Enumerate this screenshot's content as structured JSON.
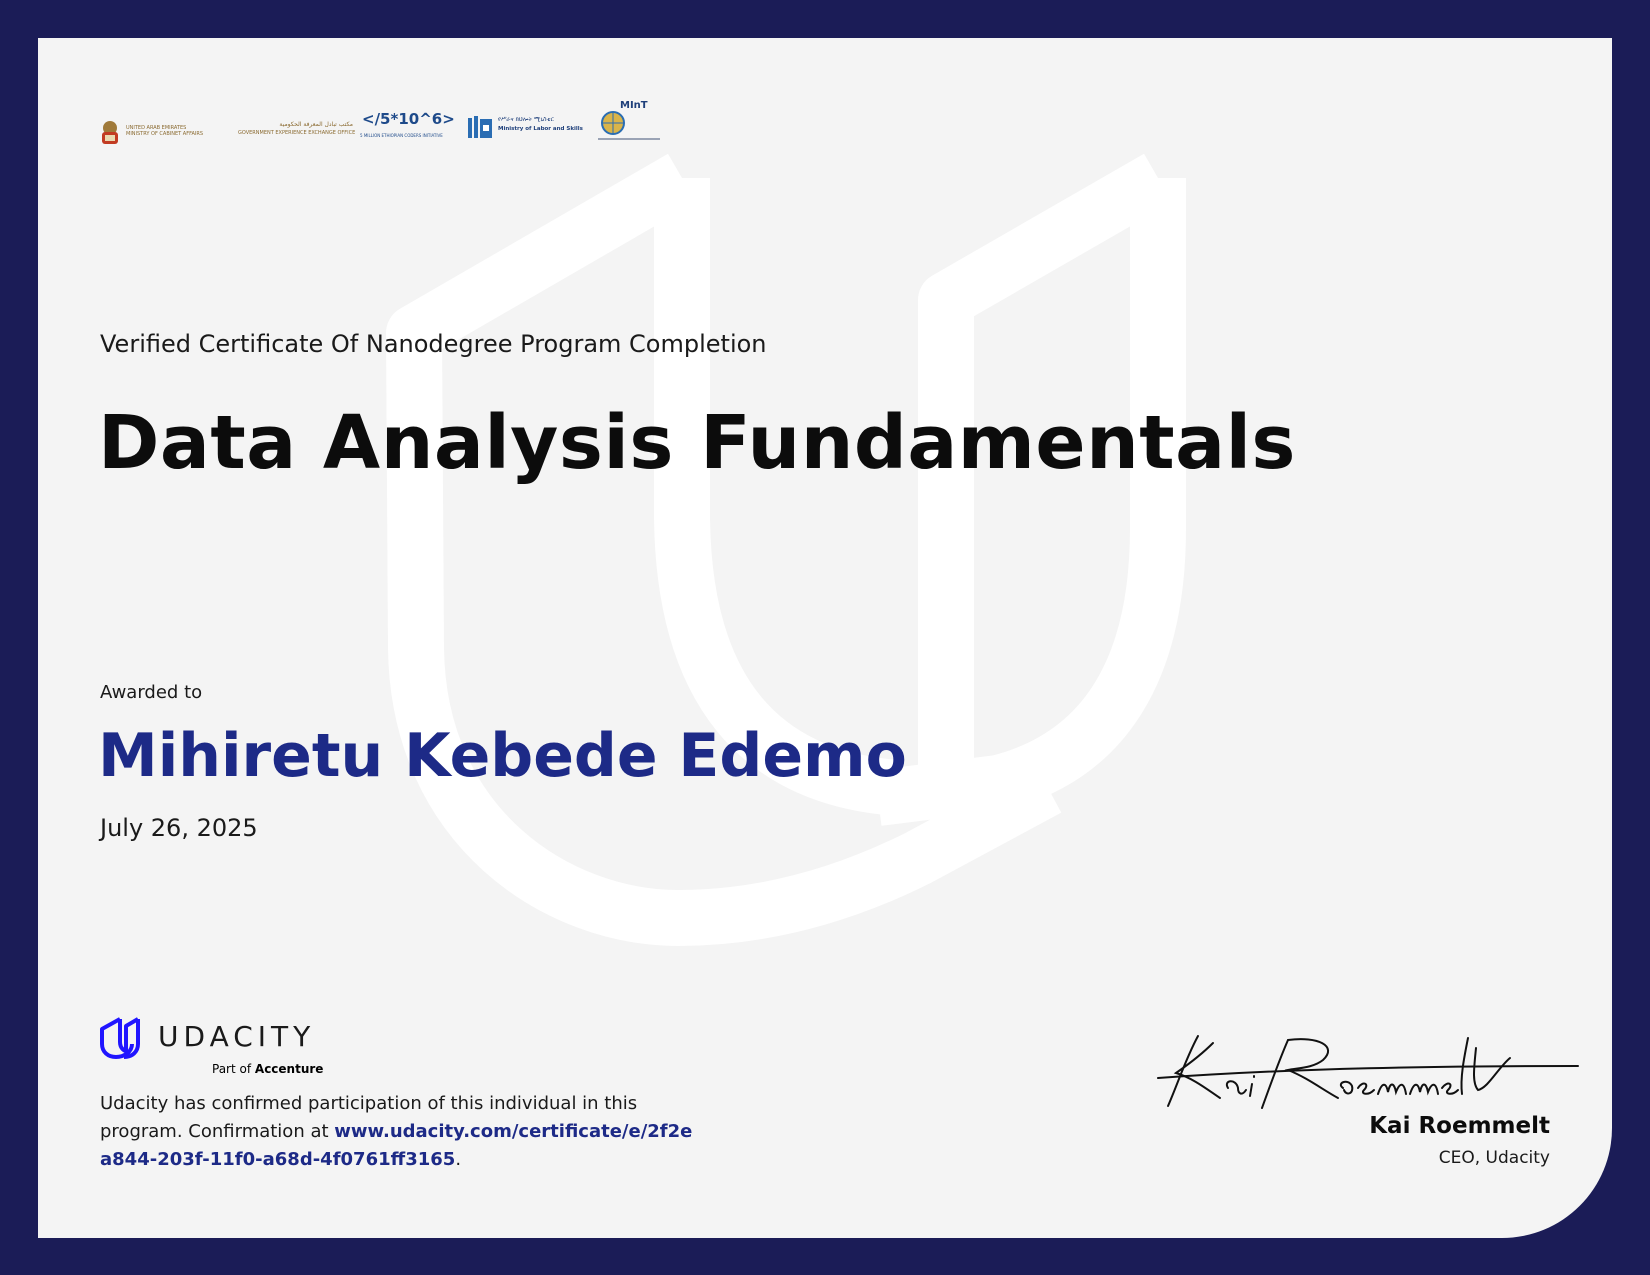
{
  "certificate": {
    "subtitle": "Verified Certificate Of Nanodegree Program Completion",
    "course_title": "Data Analysis Fundamentals",
    "awarded_label": "Awarded to",
    "recipient": "Mihiretu Kebede Edemo",
    "date": "July 26, 2025"
  },
  "partner_logos": [
    {
      "name": "uae-ministry-logo",
      "line1": "UNITED ARAB EMIRATES",
      "line2": "MINISTRY OF CABINET AFFAIRS"
    },
    {
      "name": "government-experience-exchange-logo",
      "line1": "مكتب تبادل المعرفة الحكومية",
      "line2": "GOVERNMENT EXPERIENCE EXCHANGE OFFICE"
    },
    {
      "name": "five-million-coders-logo",
      "line1": "</5*10^6>",
      "line2": "5 MILLION ETHIOPIAN CODERS INITIATIVE"
    },
    {
      "name": "ministry-labor-skills-logo",
      "line1": "የሥራና ክህሎት ሚኒስቴር",
      "line2": "Ministry of Labor and Skills"
    },
    {
      "name": "mint-logo",
      "line1": "MInT",
      "line2": ""
    }
  ],
  "brand": {
    "wordmark": "UDACITY",
    "sub_prefix": "Part of",
    "sub_company": "Accenture",
    "colors": {
      "icon": "#2015ff",
      "background": "#1b1c57",
      "accent": "#1d2a87"
    }
  },
  "confirmation": {
    "text_before": "Udacity has confirmed participation of this individual in this program. Confirmation at ",
    "url": "www.udacity.com/certificate/e/2f2ea844-203f-11f0-a68d-4f0761ff3165",
    "text_after": "."
  },
  "signature": {
    "signer_name": "Kai Roemmelt",
    "signer_role": "CEO, Udacity"
  }
}
